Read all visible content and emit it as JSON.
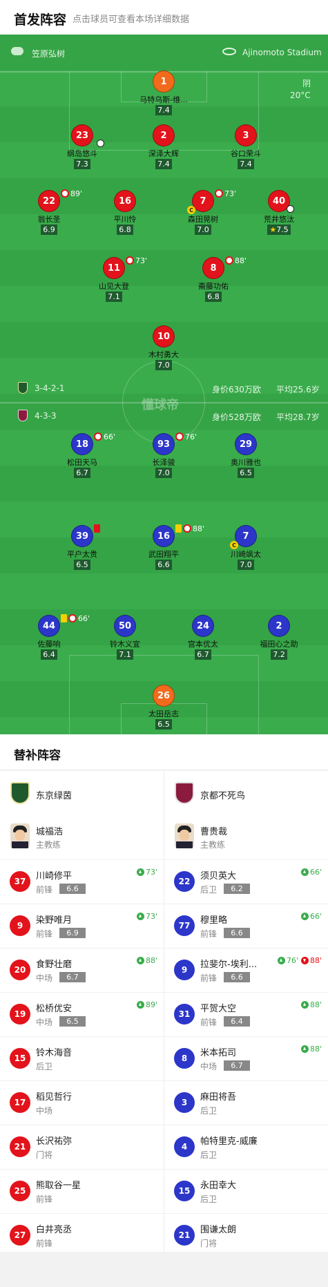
{
  "header": {
    "title": "首发阵容",
    "subtitle": "点击球员可查看本场详细数据"
  },
  "match": {
    "referee": "笠原弘树",
    "stadium": "Ajinomoto Stadium",
    "weather": "阴",
    "temperature": "20°C",
    "watermark": "懂球帝"
  },
  "home_formation": {
    "formation": "3-4-2-1",
    "value": "身价630万欧",
    "age": "平均25.6岁"
  },
  "away_formation": {
    "formation": "4-3-3",
    "value": "身价528万欧",
    "age": "平均28.7岁"
  },
  "home_players": [
    {
      "num": "1",
      "name": "马特乌斯-维...",
      "rating": "7.4",
      "color": "orange"
    },
    {
      "num": "23",
      "name": "纲岛悠斗",
      "rating": "7.3",
      "color": "red"
    },
    {
      "num": "2",
      "name": "深泽大辉",
      "rating": "7.4",
      "color": "red"
    },
    {
      "num": "3",
      "name": "谷口荣斗",
      "rating": "7.4",
      "color": "red"
    },
    {
      "num": "22",
      "name": "翁长圣",
      "rating": "6.9",
      "color": "red",
      "sub_out": "89'"
    },
    {
      "num": "16",
      "name": "平川怜",
      "rating": "6.8",
      "color": "red"
    },
    {
      "num": "7",
      "name": "森田晃树",
      "rating": "7.0",
      "color": "red",
      "sub_out": "73'"
    },
    {
      "num": "40",
      "name": "荒井悠汰",
      "rating": "7.5",
      "color": "red"
    },
    {
      "num": "11",
      "name": "山见大登",
      "rating": "7.1",
      "color": "red",
      "sub_out": "73'"
    },
    {
      "num": "8",
      "name": "斋藤功佑",
      "rating": "6.8",
      "color": "red",
      "sub_out": "88'"
    },
    {
      "num": "10",
      "name": "木村勇大",
      "rating": "7.0",
      "color": "red"
    }
  ],
  "away_players": [
    {
      "num": "18",
      "name": "松田天马",
      "rating": "6.7",
      "color": "blue",
      "sub_out": "66'"
    },
    {
      "num": "93",
      "name": "长泽骏",
      "rating": "7.0",
      "color": "blue",
      "sub_out": "76'"
    },
    {
      "num": "29",
      "name": "奥川雅也",
      "rating": "6.5",
      "color": "blue"
    },
    {
      "num": "39",
      "name": "平户太贵",
      "rating": "6.5",
      "color": "blue"
    },
    {
      "num": "16",
      "name": "武田翔平",
      "rating": "6.6",
      "color": "blue",
      "sub_out": "88'"
    },
    {
      "num": "7",
      "name": "川崎飒太",
      "rating": "7.0",
      "color": "blue"
    },
    {
      "num": "44",
      "name": "佐藤响",
      "rating": "6.4",
      "color": "blue",
      "sub_out": "66'"
    },
    {
      "num": "50",
      "name": "铃木义宜",
      "rating": "7.1",
      "color": "blue"
    },
    {
      "num": "24",
      "name": "宫本优太",
      "rating": "6.7",
      "color": "blue"
    },
    {
      "num": "2",
      "name": "福田心之助",
      "rating": "7.2",
      "color": "blue"
    },
    {
      "num": "26",
      "name": "太田岳志",
      "rating": "6.5",
      "color": "orange"
    }
  ],
  "subs_title": "替补阵容",
  "home_team": {
    "name": "东京绿茵",
    "coach": "城福浩",
    "coach_role": "主教练"
  },
  "away_team": {
    "name": "京都不死鸟",
    "coach": "曹贵裁",
    "coach_role": "主教练"
  },
  "home_subs": [
    {
      "num": "37",
      "name": "川崎修平",
      "pos": "前锋",
      "rating": "6.6",
      "in": "73'"
    },
    {
      "num": "9",
      "name": "染野唯月",
      "pos": "前锋",
      "rating": "6.9",
      "in": "73'"
    },
    {
      "num": "20",
      "name": "食野壮磨",
      "pos": "中场",
      "rating": "6.7",
      "in": "88'"
    },
    {
      "num": "19",
      "name": "松桥优安",
      "pos": "中场",
      "rating": "6.5",
      "in": "89'"
    },
    {
      "num": "15",
      "name": "铃木海音",
      "pos": "后卫"
    },
    {
      "num": "17",
      "name": "稻见哲行",
      "pos": "中场"
    },
    {
      "num": "21",
      "name": "长沢祐弥",
      "pos": "门将"
    },
    {
      "num": "25",
      "name": "熊取谷一星",
      "pos": "前锋"
    },
    {
      "num": "27",
      "name": "白井亮丞",
      "pos": "前锋"
    }
  ],
  "away_subs": [
    {
      "num": "22",
      "name": "须贝英大",
      "pos": "后卫",
      "rating": "6.2",
      "in": "66'"
    },
    {
      "num": "77",
      "name": "穆里略",
      "pos": "前锋",
      "rating": "6.6",
      "in": "66'"
    },
    {
      "num": "9",
      "name": "拉斐尔-埃利...",
      "pos": "前锋",
      "rating": "6.6",
      "in": "76'",
      "out": "88'"
    },
    {
      "num": "31",
      "name": "平贺大空",
      "pos": "前锋",
      "rating": "6.4",
      "in": "88'"
    },
    {
      "num": "8",
      "name": "米本拓司",
      "pos": "中场",
      "rating": "6.7",
      "in": "88'"
    },
    {
      "num": "3",
      "name": "麻田将吾",
      "pos": "后卫"
    },
    {
      "num": "4",
      "name": "帕特里克-威廉",
      "pos": "后卫"
    },
    {
      "num": "15",
      "name": "永田幸大",
      "pos": "后卫"
    },
    {
      "num": "21",
      "name": "围谦太朗",
      "pos": "门将"
    }
  ],
  "colors": {
    "pitch": "#3aac4c",
    "home": "#e3131b",
    "away": "#2c36c9",
    "gk": "#f26a1b"
  }
}
